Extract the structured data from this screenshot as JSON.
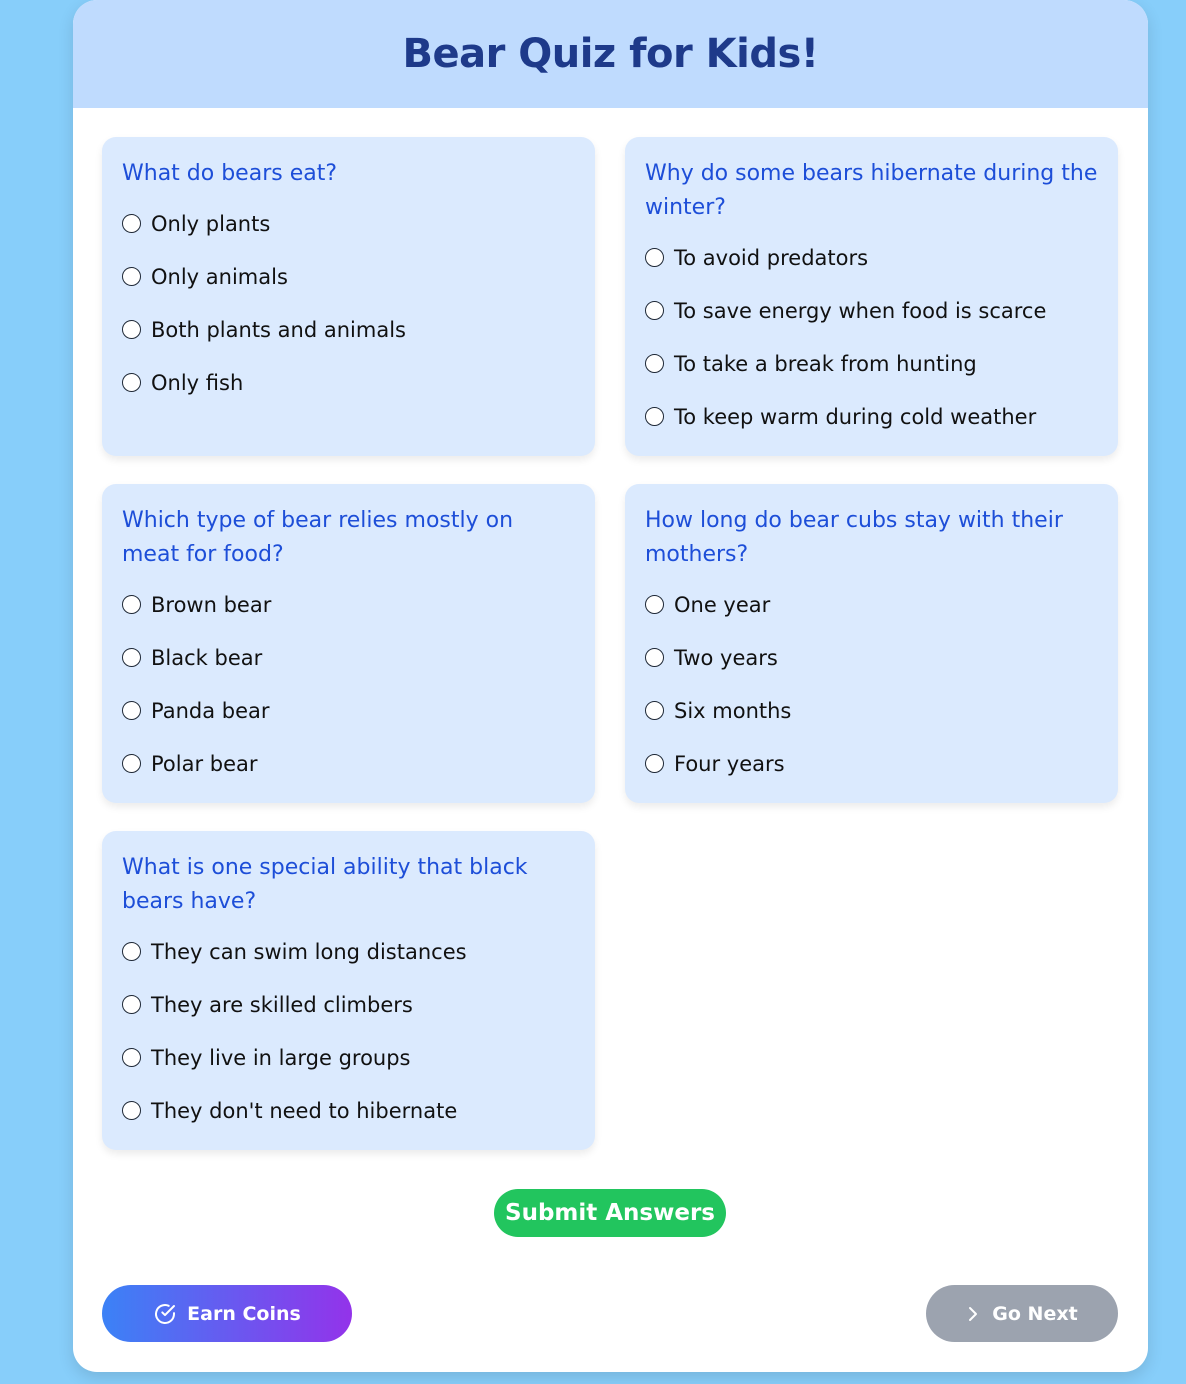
{
  "header": {
    "title": "Bear Quiz for Kids!"
  },
  "questions": [
    {
      "title": "What do bears eat?",
      "options": [
        "Only plants",
        "Only animals",
        "Both plants and animals",
        "Only fish"
      ]
    },
    {
      "title": "Why do some bears hibernate during the winter?",
      "options": [
        "To avoid predators",
        "To save energy when food is scarce",
        "To take a break from hunting",
        "To keep warm during cold weather"
      ]
    },
    {
      "title": "Which type of bear relies mostly on meat for food?",
      "options": [
        "Brown bear",
        "Black bear",
        "Panda bear",
        "Polar bear"
      ]
    },
    {
      "title": "How long do bear cubs stay with their mothers?",
      "options": [
        "One year",
        "Two years",
        "Six months",
        "Four years"
      ]
    },
    {
      "title": "What is one special ability that black bears have?",
      "options": [
        "They can swim long distances",
        "They are skilled climbers",
        "They live in large groups",
        "They don't need to hibernate"
      ]
    }
  ],
  "actions": {
    "submit_label": "Submit Answers",
    "earn_label": "Earn Coins",
    "earn_icon": "check-circle-icon",
    "next_label": "Go Next",
    "next_icon": "chevron-right-icon"
  },
  "colors": {
    "page_bg": "#87cefa",
    "header_bg": "#bfdbfe",
    "title": "#1e3a8a",
    "question_bg": "#dbeafe",
    "question_text": "#1d4ed8",
    "submit_bg": "#22c55e",
    "earn_gradient_start": "#3b82f6",
    "earn_gradient_end": "#9333ea",
    "next_bg": "#9ca3af"
  }
}
